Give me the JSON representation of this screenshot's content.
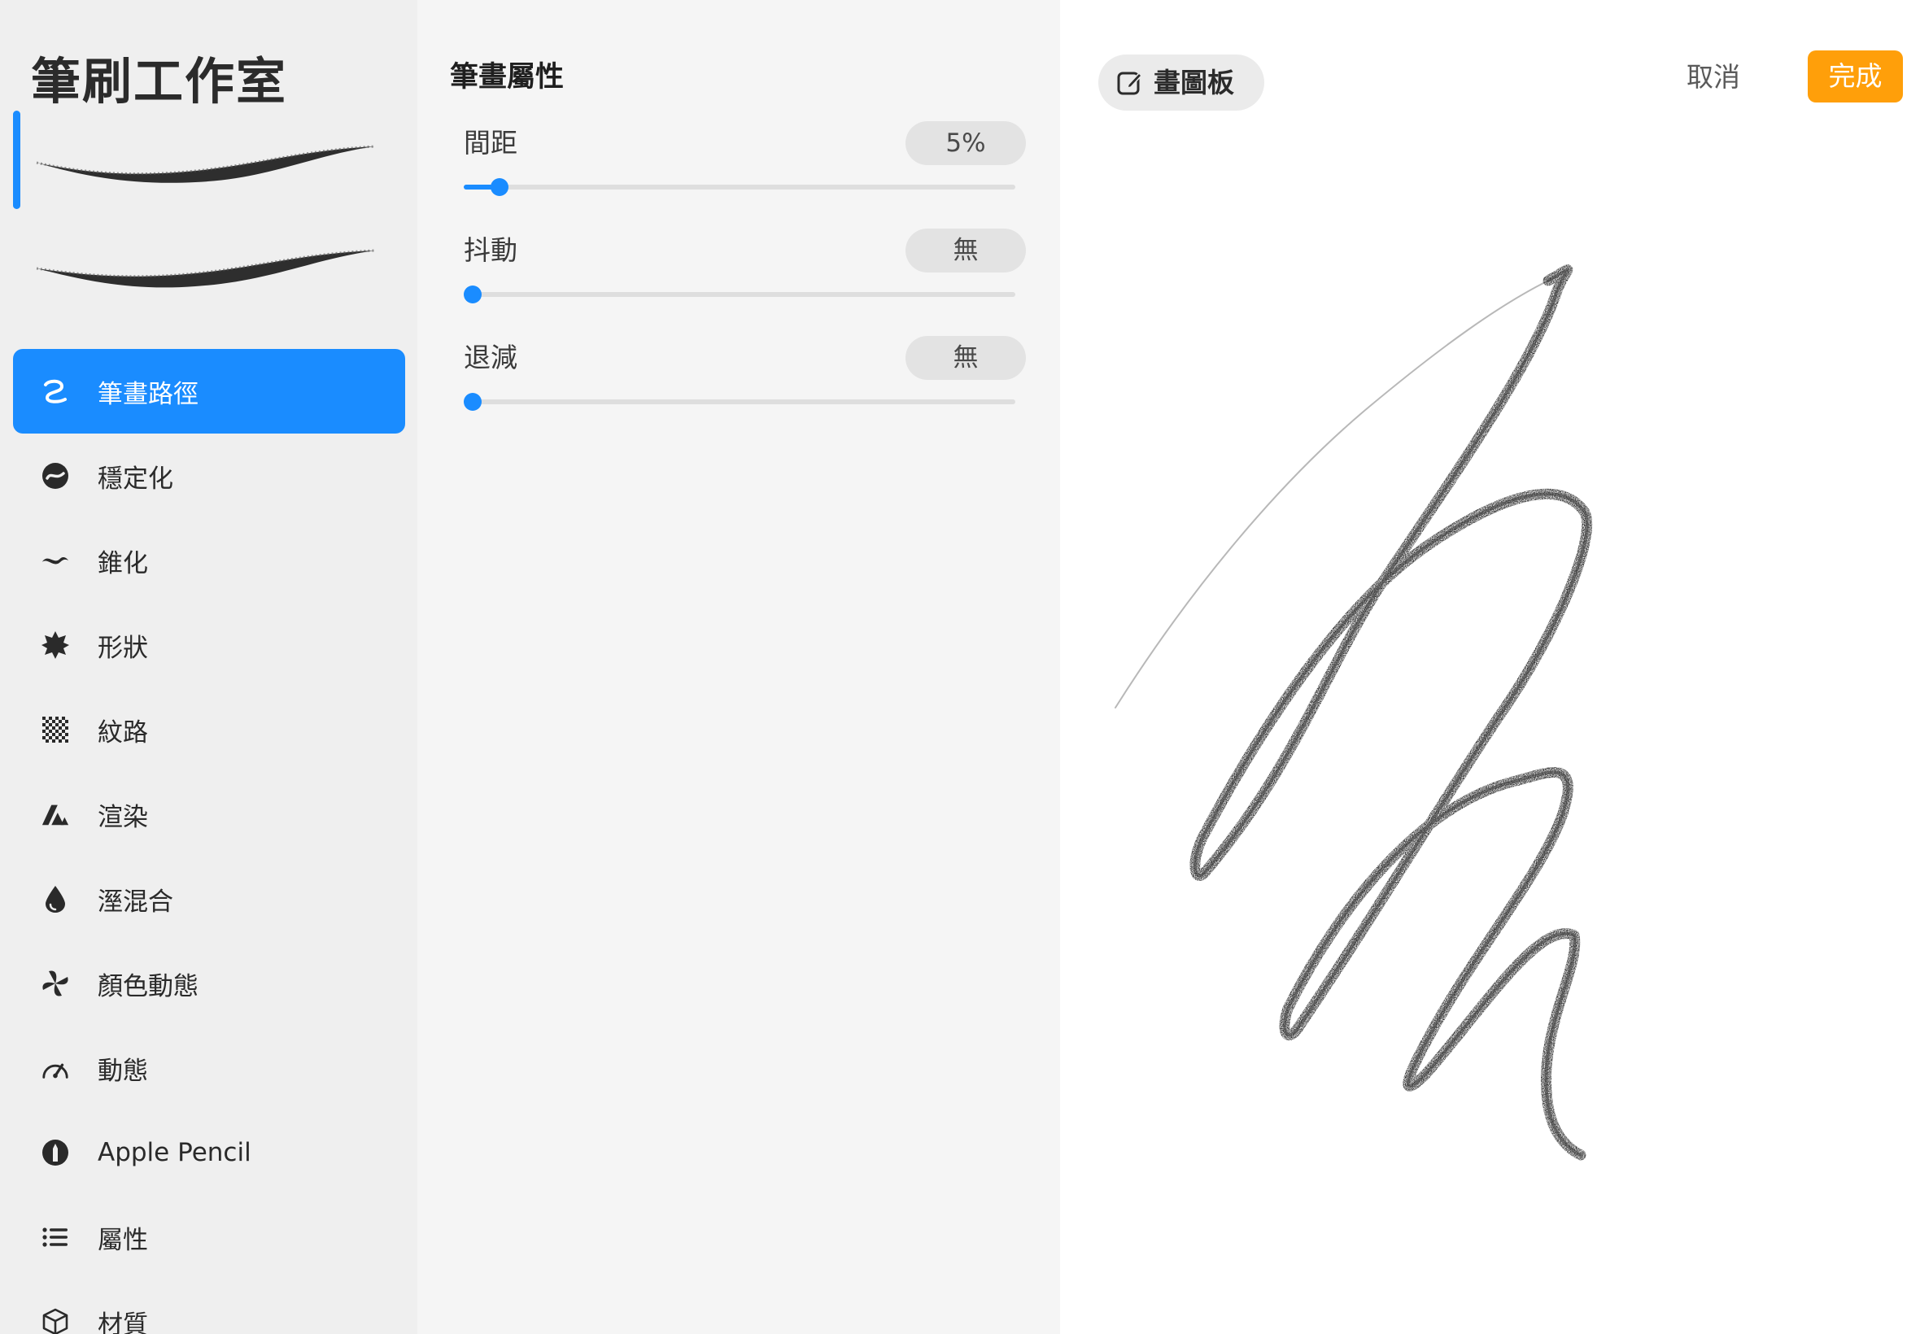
{
  "sidebar": {
    "title": "筆刷工作室",
    "items": [
      {
        "label": "筆畫路徑",
        "icon": "stroke-path-icon",
        "active": true
      },
      {
        "label": "穩定化",
        "icon": "stabilization-icon",
        "active": false
      },
      {
        "label": "錐化",
        "icon": "taper-icon",
        "active": false
      },
      {
        "label": "形狀",
        "icon": "shape-icon",
        "active": false
      },
      {
        "label": "紋路",
        "icon": "grain-icon",
        "active": false
      },
      {
        "label": "渲染",
        "icon": "rendering-icon",
        "active": false
      },
      {
        "label": "溼混合",
        "icon": "wet-mix-icon",
        "active": false
      },
      {
        "label": "顏色動態",
        "icon": "color-dynamics-icon",
        "active": false
      },
      {
        "label": "動態",
        "icon": "dynamics-icon",
        "active": false
      },
      {
        "label": "Apple Pencil",
        "icon": "apple-pencil-icon",
        "active": false
      },
      {
        "label": "屬性",
        "icon": "properties-list-icon",
        "active": false
      },
      {
        "label": "材質",
        "icon": "materials-cube-icon",
        "active": false
      }
    ]
  },
  "properties": {
    "title": "筆畫屬性",
    "rows": [
      {
        "label": "間距",
        "value": "5%",
        "level": 0.05
      },
      {
        "label": "抖動",
        "value": "無",
        "level": 0
      },
      {
        "label": "退減",
        "value": "無",
        "level": 0
      }
    ]
  },
  "canvas": {
    "pad_label": "畫圖板",
    "cancel_label": "取消",
    "done_label": "完成"
  },
  "colors": {
    "accent": "#1a8cff",
    "done": "#ff9f0a",
    "sidebar_bg": "#efefef",
    "panel_bg": "#f5f5f5"
  }
}
